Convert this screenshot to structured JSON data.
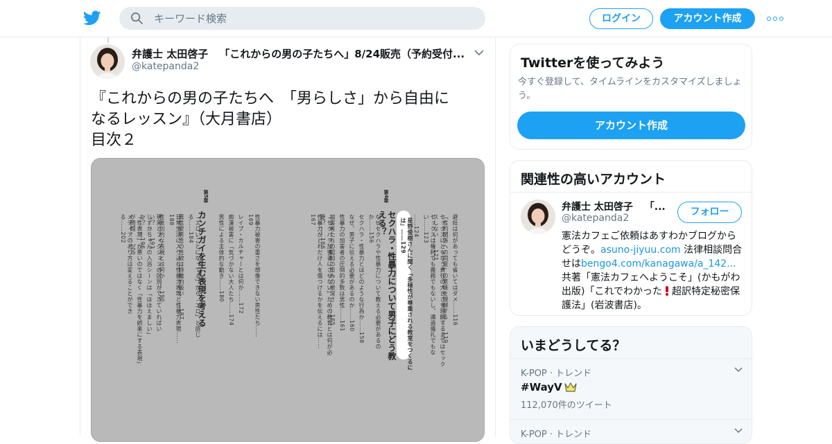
{
  "header": {
    "search_placeholder": "キーワード検索",
    "login_label": "ログイン",
    "signup_label": "アカウント作成",
    "brand_color": "#1da1f2"
  },
  "tweet": {
    "display_name": "弁護士 太田啓子",
    "bio_snippet": "「これからの男の子たちへ」8/24販売（予約受付...",
    "handle": "@katepanda2",
    "text_lines": [
      "『これからの男の子たちへ　「男らしさ」から自由に",
      "なるレッスン』（大月書店）",
      "目次２"
    ],
    "photo": {
      "chapter5_label": "第5章",
      "chapter5_title": "カンチガイを生む表現を考える",
      "chapter5_entries": [
        "性暴力被害の重さを想像できない男性たち……169",
        "レイプ・カルチャーとは何か……172",
        "痴漢被害に「気づかない大人たち……174",
        "男性による主体的な動き……180",
        "「エロいことになってる」から「エロ」と感じる……184",
        "異性愛男性の性欲は特権的扱い……187",
        "日常生活に入り込む性暴力表現と性暴力表現……188",
        "性差別的な表現とは何か……190",
        "現実とフィクションの区別ができていればいい？……193",
        "しずかちゃんの入浴シーンは「ほほえましい」か？……196",
        "「性表現」が悪いのではなく「性暴力を娯楽にする表現」が問題……200",
        "メディアのあり方は変えることができる……202"
      ],
      "chapter4_label": "第4章",
      "chapter4_title": "セクハラ・性暴力について男子にどう教える？",
      "chapter4_entries": [
        "なぜセクハラや性暴力について教える必要があるのか……156",
        "セクハラ・性暴力とはどのような行為か……158",
        "なぜ、男子に伝える必要があるのか……160",
        "性暴力の加害者の圧倒的多数は男性……161",
        "加害者たちの認知の歪みの根深さ……165",
        "「セクハラ加害者にさせない」ための教育とは何が必要？……166",
        "性暴力がどれだけ人を傷つけるかを伝えるには……167"
      ],
      "interview_title": "星野俊樹さんに聞く「多様性が尊重される教室をつくるには」……129",
      "chapter3_entries": [
        "避妊は何があっても省いてはダメ……116",
        "「性的関係への同意」の意味を理解する……119",
        "セックスにともなう責任の大きさを理解するまではセックスしない……121",
        "セックスは権利でも義務でもないし、通過儀礼でもない……123",
        "……124"
      ]
    }
  },
  "sidebar": {
    "try_card": {
      "title": "Twitterを使ってみよう",
      "desc": "今すぐ登録して、タイムラインをカスタマイズしましょう。",
      "cta": "アカウント作成"
    },
    "relevant_card": {
      "title": "関連性の高いアカウント",
      "name": "弁護士 太田啓子",
      "name_suffix": "「...",
      "handle": "@katepanda2",
      "follow_label": "フォロー",
      "desc_1": "憲法カフェご依頼はあすわかブログからどうぞ。",
      "link_1": "asuno-jiyuu.com",
      "desc_2": " 法律相談問合せは",
      "link_2": "bengo4.com/kanagawa/a_142...",
      "desc_3": " 共著「憲法カフェへようこそ」(かもがわ出版)「これでわかった",
      "desc_4": "超訳特定秘密保護法」(岩波書店)。"
    },
    "trends_card": {
      "title": "いまどうしてる？",
      "trends": [
        {
          "meta": "K-POP · トレンド",
          "tag": "#WayV",
          "count": "112,070件のツイート"
        },
        {
          "meta": "K-POP · トレンド",
          "tag": "",
          "count": ""
        }
      ]
    }
  }
}
